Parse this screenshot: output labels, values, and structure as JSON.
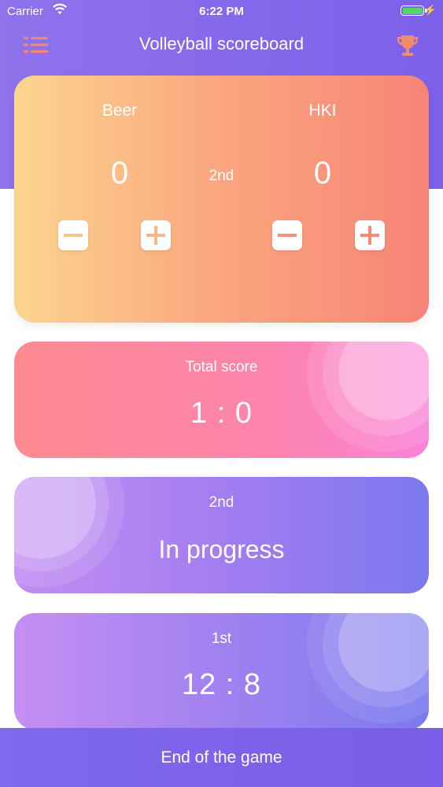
{
  "status_bar": {
    "carrier": "Carrier",
    "time": "6:22 PM"
  },
  "header": {
    "title": "Volleyball scoreboard",
    "menu_icon": "menu-list-icon",
    "trophy_icon": "trophy-icon"
  },
  "scoreboard": {
    "team_a": {
      "name": "Beer",
      "score": "0"
    },
    "team_b": {
      "name": "HKI",
      "score": "0"
    },
    "current_set": "2nd"
  },
  "total_score": {
    "label": "Total score",
    "value": "1 : 0"
  },
  "current_set_card": {
    "label": "2nd",
    "status": "In progress"
  },
  "set_cards": [
    {
      "label": "1st",
      "score": "12 : 8"
    }
  ],
  "footer": {
    "end_label": "End of the game"
  },
  "colors": {
    "header_purple": "#7c60ea",
    "accent_orange": "#f28a6e",
    "battery_green": "#4cd964"
  }
}
